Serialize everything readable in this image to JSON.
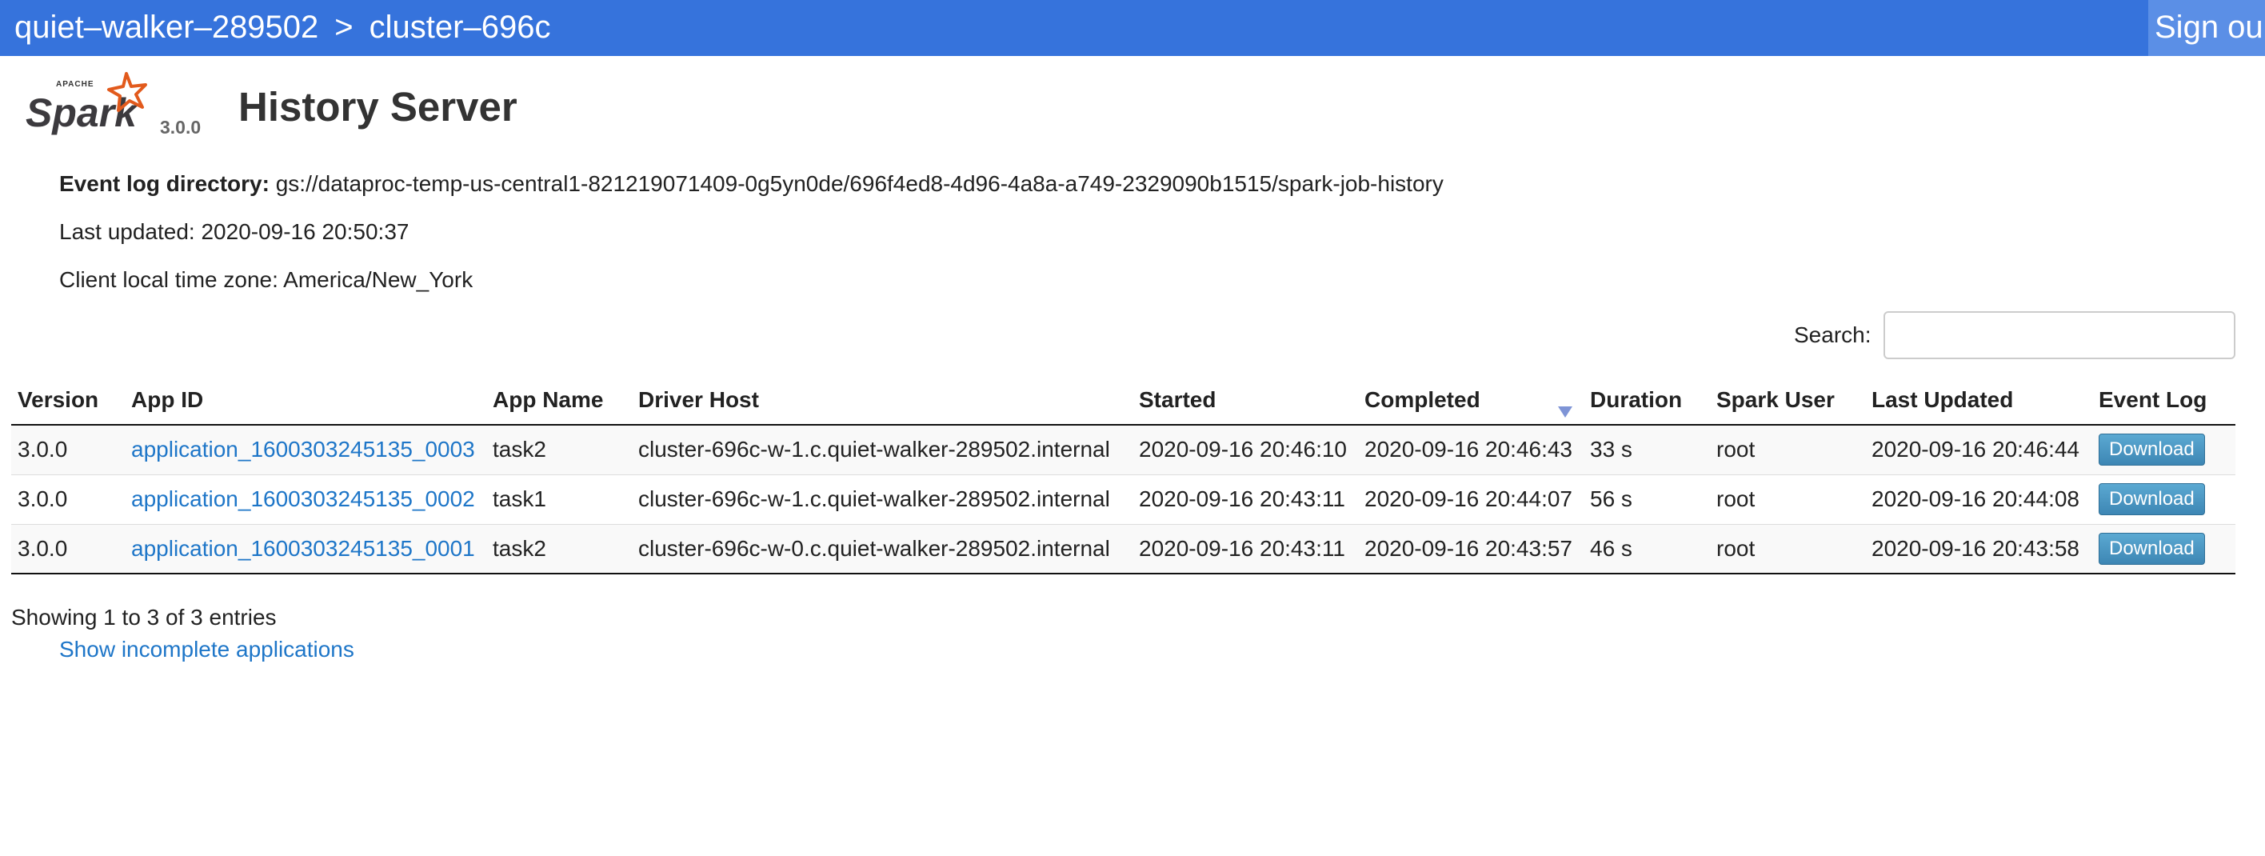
{
  "header": {
    "project": "quiet–walker–289502",
    "separator": ">",
    "cluster": "cluster–696c",
    "sign_out": "Sign ou"
  },
  "logo": {
    "apache_text": "APACHE",
    "brand": "Spark",
    "version": "3.0.0"
  },
  "page_title": "History Server",
  "info": {
    "event_log_label": "Event log directory:",
    "event_log_value": "gs://dataproc-temp-us-central1-821219071409-0g5yn0de/696f4ed8-4d96-4a8a-a749-2329090b1515/spark-job-history",
    "last_updated": "Last updated: 2020-09-16 20:50:37",
    "timezone": "Client local time zone: America/New_York"
  },
  "search": {
    "label": "Search:",
    "value": ""
  },
  "table": {
    "headers": [
      "Version",
      "App ID",
      "App Name",
      "Driver Host",
      "Started",
      "Completed",
      "Duration",
      "Spark User",
      "Last Updated",
      "Event Log"
    ],
    "rows": [
      {
        "version": "3.0.0",
        "app_id": "application_1600303245135_0003",
        "app_name": "task2",
        "driver_host": "cluster-696c-w-1.c.quiet-walker-289502.internal",
        "started": "2020-09-16 20:46:10",
        "completed": "2020-09-16 20:46:43",
        "duration": "33 s",
        "user": "root",
        "last_updated": "2020-09-16 20:46:44",
        "event_log": "Download"
      },
      {
        "version": "3.0.0",
        "app_id": "application_1600303245135_0002",
        "app_name": "task1",
        "driver_host": "cluster-696c-w-1.c.quiet-walker-289502.internal",
        "started": "2020-09-16 20:43:11",
        "completed": "2020-09-16 20:44:07",
        "duration": "56 s",
        "user": "root",
        "last_updated": "2020-09-16 20:44:08",
        "event_log": "Download"
      },
      {
        "version": "3.0.0",
        "app_id": "application_1600303245135_0001",
        "app_name": "task2",
        "driver_host": "cluster-696c-w-0.c.quiet-walker-289502.internal",
        "started": "2020-09-16 20:43:11",
        "completed": "2020-09-16 20:43:57",
        "duration": "46 s",
        "user": "root",
        "last_updated": "2020-09-16 20:43:58",
        "event_log": "Download"
      }
    ]
  },
  "footer": {
    "entries_info": "Showing 1 to 3 of 3 entries",
    "incomplete_link": "Show incomplete applications"
  },
  "colors": {
    "header_bg": "#3673dc",
    "link": "#1e76c8",
    "button": "#4f9ac4",
    "spark_orange": "#e25a1c"
  },
  "icons": {
    "logo": "spark-star-logo",
    "sort": "sort-descending-icon"
  }
}
